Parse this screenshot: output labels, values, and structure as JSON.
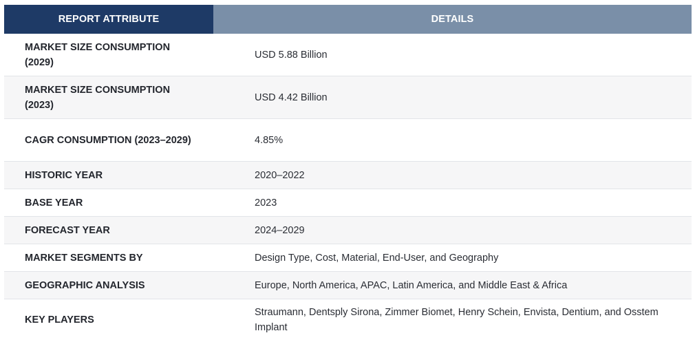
{
  "header": {
    "attribute": "REPORT ATTRIBUTE",
    "details": "DETAILS"
  },
  "rows": [
    {
      "attribute": "MARKET SIZE CONSUMPTION (2029)",
      "details": "USD 5.88 Billion"
    },
    {
      "attribute": "MARKET SIZE CONSUMPTION (2023)",
      "details": "USD 4.42 Billion"
    },
    {
      "attribute": "CAGR CONSUMPTION (2023–2029)",
      "details": "4.85%"
    },
    {
      "attribute": "HISTORIC YEAR",
      "details": "2020–2022"
    },
    {
      "attribute": "BASE YEAR",
      "details": "2023"
    },
    {
      "attribute": "FORECAST YEAR",
      "details": "2024–2029"
    },
    {
      "attribute": "MARKET SEGMENTS BY",
      "details": "Design Type, Cost, Material, End-User, and Geography"
    },
    {
      "attribute": "GEOGRAPHIC ANALYSIS",
      "details": "Europe, North America, APAC, Latin America, and Middle East & Africa"
    },
    {
      "attribute": "KEY PLAYERS",
      "details": "Straumann, Dentsply Sirona, Zimmer Biomet, Henry Schein, Envista, Dentium, and Osstem Implant"
    }
  ],
  "colors": {
    "header_attribute_bg": "#1e3a66",
    "header_details_bg": "#7a8fa8",
    "row_alt_bg": "#f6f6f7"
  }
}
